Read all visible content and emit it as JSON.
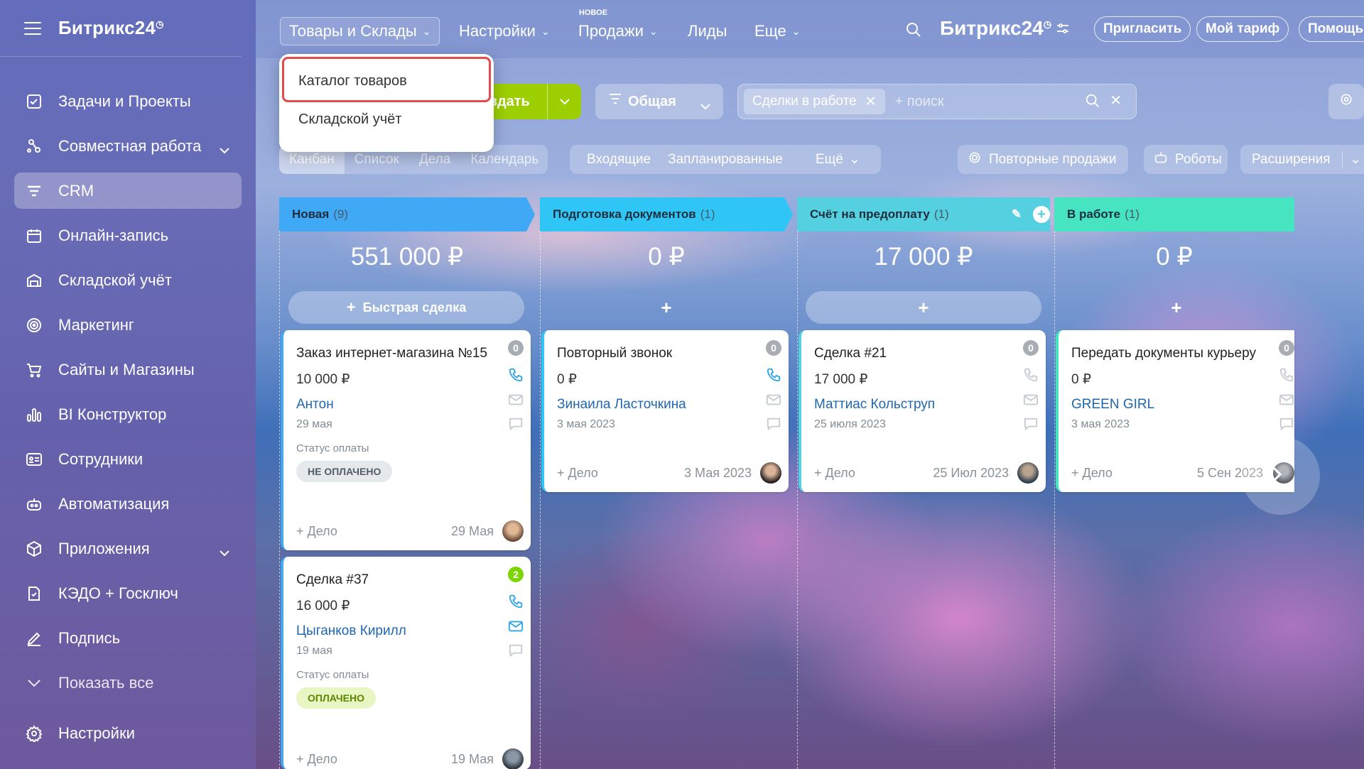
{
  "sidebar": {
    "logo": "Битрикс24",
    "items": [
      {
        "label": "Задачи и Проекты",
        "icon": "tasks-icon"
      },
      {
        "label": "Совместная работа",
        "icon": "collab-icon",
        "expandable": true
      },
      {
        "label": "CRM",
        "icon": "crm-icon",
        "active": true
      },
      {
        "label": "Онлайн-запись",
        "icon": "calendar-icon"
      },
      {
        "label": "Складской учёт",
        "icon": "warehouse-icon"
      },
      {
        "label": "Маркетинг",
        "icon": "marketing-icon"
      },
      {
        "label": "Сайты и Магазины",
        "icon": "cart-icon"
      },
      {
        "label": "BI Конструктор",
        "icon": "bi-icon"
      },
      {
        "label": "Сотрудники",
        "icon": "employees-icon"
      },
      {
        "label": "Автоматизация",
        "icon": "robot-icon"
      },
      {
        "label": "Приложения",
        "icon": "apps-icon",
        "expandable": true
      },
      {
        "label": "КЭДО + Госключ",
        "icon": "kedo-icon"
      },
      {
        "label": "Подпись",
        "icon": "sign-icon"
      },
      {
        "label": "Показать все",
        "icon": "chevron-down-icon"
      },
      {
        "label": "Настройки",
        "icon": "gear-icon"
      }
    ]
  },
  "topbar": {
    "menu": [
      "Товары и Склады",
      "Настройки",
      "Продажи",
      "Лиды",
      "Еще"
    ],
    "new_badge": "НОВОЕ",
    "logo": "Битрикс24",
    "invite": "Пригласить",
    "tariff": "Мой тариф",
    "help": "Помощь"
  },
  "dropdown": {
    "items": [
      "Каталог товаров",
      "Складской учёт"
    ]
  },
  "toolbar": {
    "create": "здать",
    "pipeline": "Общая",
    "filter_tag": "Сделки в работе",
    "search_placeholder": "+ поиск"
  },
  "views": {
    "tabs": [
      "Канбан",
      "Список",
      "Дела",
      "Календарь"
    ],
    "counters": [
      "Входящие",
      "Запланированные",
      "Ещё"
    ],
    "repeat_sales": "Повторные продажи",
    "robots": "Роботы",
    "extensions": "Расширения"
  },
  "columns": [
    {
      "title": "Новая",
      "count": "(9)",
      "total": "551 000 ₽",
      "quick": "Быстрая сделка",
      "color": "#3fa9f5"
    },
    {
      "title": "Подготовка документов",
      "count": "(1)",
      "total": "0 ₽",
      "quick": "+",
      "color": "#2fc6f6"
    },
    {
      "title": "Счёт на предоплату",
      "count": "(1)",
      "total": "17 000 ₽",
      "quick": "+",
      "color": "#55d0e0"
    },
    {
      "title": "В работе",
      "count": "(1)",
      "total": "0 ₽",
      "quick": "+",
      "color": "#47e4c2"
    }
  ],
  "cards": [
    {
      "title": "Заказ интернет-магазина №15",
      "amount": "10 000 ₽",
      "client": "Антон",
      "date": "29 мая",
      "badge": "0",
      "pay_label": "Статус оплаты",
      "pay_status": "НЕ ОПЛАЧЕНО",
      "delo": "+ Дело",
      "fdate": "29 Мая"
    },
    {
      "title": "Сделка #37",
      "amount": "16 000 ₽",
      "client": "Цыганков Кирилл",
      "date": "19 мая",
      "badge": "2",
      "pay_label": "Статус оплаты",
      "pay_status": "ОПЛАЧЕНО",
      "delo": "+ Дело",
      "fdate": "19 Мая"
    },
    {
      "title": "Повторный звонок",
      "amount": "0 ₽",
      "client": "Зинаила Ласточкина",
      "date": "3 мая 2023",
      "badge": "0",
      "delo": "+ Дело",
      "fdate": "3 Мая 2023"
    },
    {
      "title": "Сделка #21",
      "amount": "17 000 ₽",
      "client": "Маттиас Кольструп",
      "date": "25 июля 2023",
      "badge": "0",
      "delo": "+ Дело",
      "fdate": "25 Июл 2023"
    },
    {
      "title": "Передать документы курьеру",
      "amount": "0 ₽",
      "client": "GREEN GIRL",
      "date": "3 мая 2023",
      "badge": "0",
      "delo": "+ Дело",
      "fdate": "5 Сен 2023"
    }
  ]
}
